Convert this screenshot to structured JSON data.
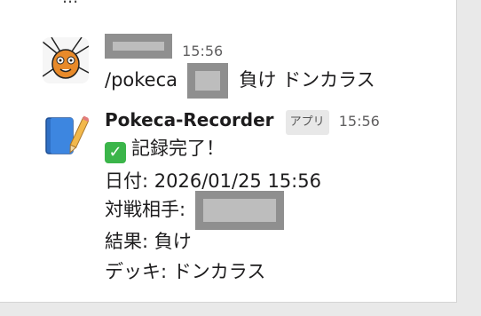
{
  "partial_top_text": "...",
  "user_message": {
    "time": "15:56",
    "command": "/pokeca",
    "result_text": "負け ドンカラス"
  },
  "bot_message": {
    "name": "Pokeca-Recorder",
    "badge": "アプリ",
    "time": "15:56",
    "lines": {
      "status": "記録完了！",
      "status_icon": "check-mark",
      "date_line": "日付: 2026/01/25 15:56",
      "opponent_label": "対戦相手:",
      "result_line": "結果: 負け",
      "deck_line": "デッキ: ドンカラス"
    }
  }
}
